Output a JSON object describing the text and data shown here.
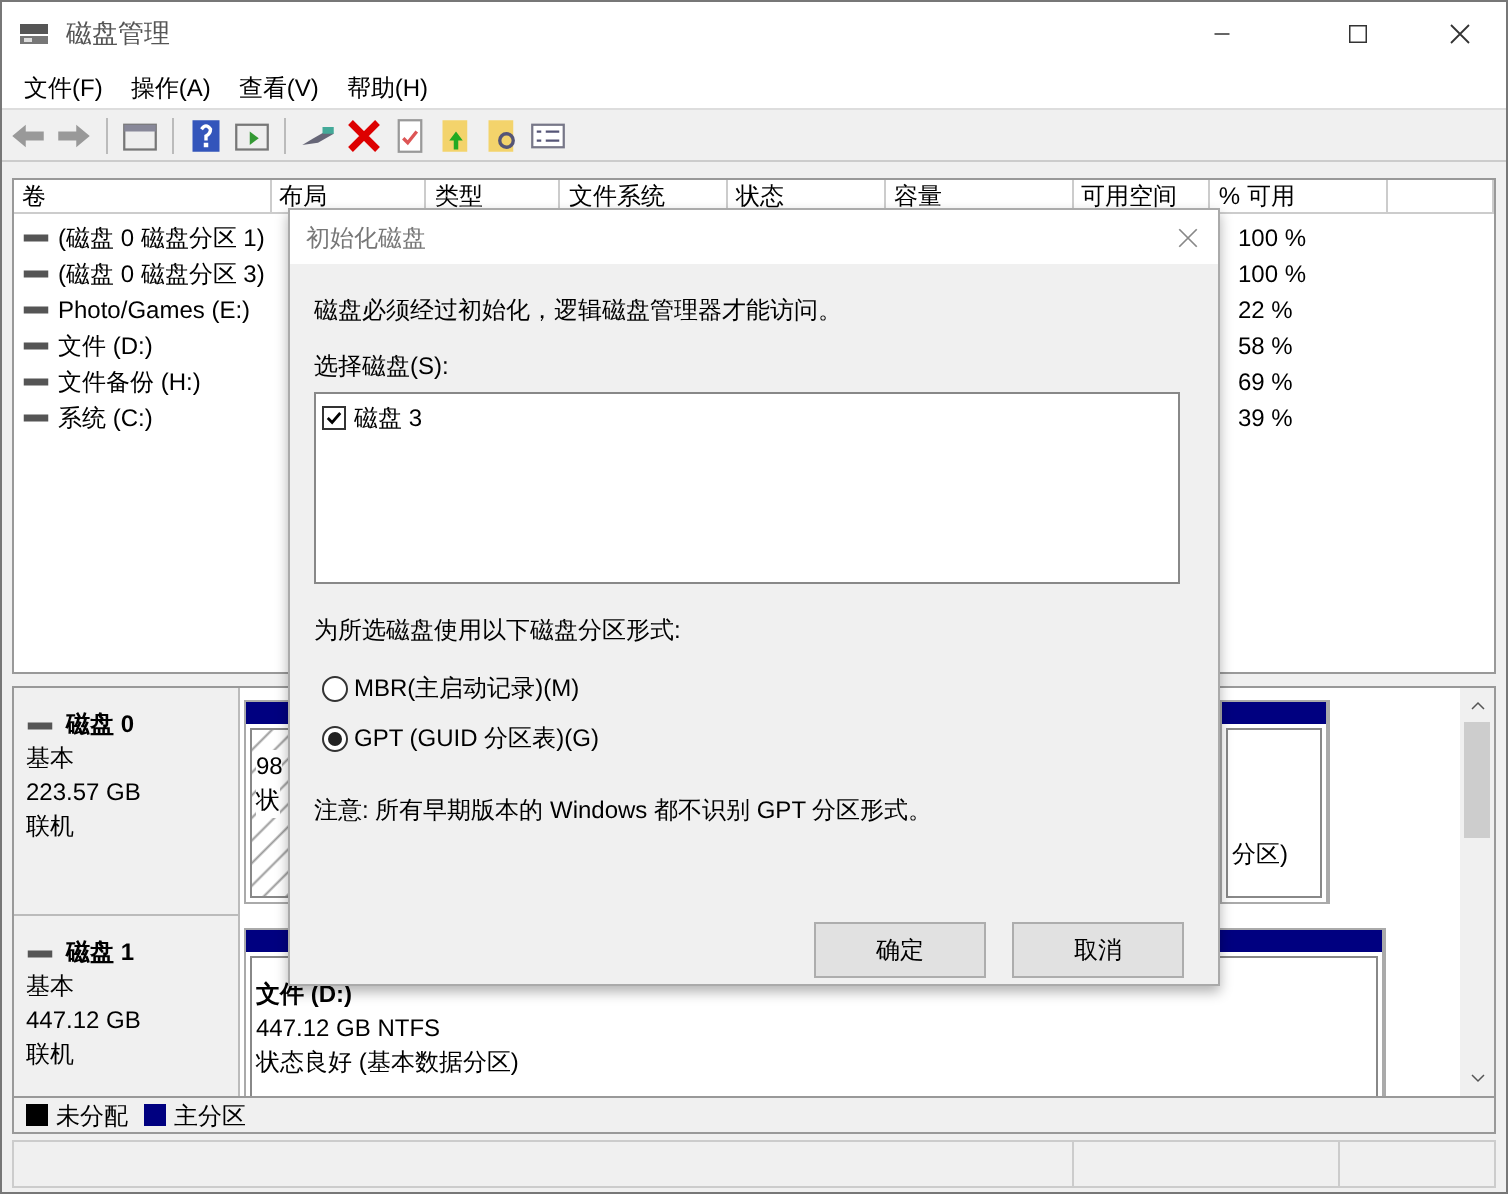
{
  "window": {
    "title": "磁盘管理"
  },
  "menu": [
    "文件(F)",
    "操作(A)",
    "查看(V)",
    "帮助(H)"
  ],
  "volume_table": {
    "columns": [
      "卷",
      "布局",
      "类型",
      "文件系统",
      "状态",
      "容量",
      "可用空间",
      "% 可用"
    ],
    "rows": [
      {
        "volume": "(磁盘 0 磁盘分区 1)",
        "percent_free": "100 %"
      },
      {
        "volume": "(磁盘 0 磁盘分区 3)",
        "percent_free": "100 %"
      },
      {
        "volume": "Photo/Games (E:)",
        "percent_free": "22 %"
      },
      {
        "volume": "文件 (D:)",
        "percent_free": "58 %"
      },
      {
        "volume": "文件备份 (H:)",
        "percent_free": "69 %"
      },
      {
        "volume": "系统 (C:)",
        "percent_free": "39 %"
      }
    ]
  },
  "disks": [
    {
      "name": "磁盘 0",
      "type": "基本",
      "size": "223.57 GB",
      "status": "联机",
      "partitions": [
        {
          "kind": "hatched",
          "lines": [
            "98",
            "状"
          ]
        },
        {
          "kind": "primary",
          "lines": [
            "分区)"
          ]
        }
      ]
    },
    {
      "name": "磁盘 1",
      "type": "基本",
      "size": "447.12 GB",
      "status": "联机",
      "partitions": [
        {
          "kind": "primary",
          "title": "文件 (D:)",
          "lines": [
            "447.12 GB NTFS",
            "状态良好 (基本数据分区)"
          ]
        }
      ]
    }
  ],
  "legend": [
    {
      "label": "未分配",
      "color": "#000000"
    },
    {
      "label": "主分区",
      "color": "#000080"
    }
  ],
  "dialog": {
    "title": "初始化磁盘",
    "message": "磁盘必须经过初始化，逻辑磁盘管理器才能访问。",
    "select_label": "选择磁盘(S):",
    "disks": [
      {
        "label": "磁盘 3",
        "checked": true
      }
    ],
    "style_label": "为所选磁盘使用以下磁盘分区形式:",
    "options": [
      {
        "label": "MBR(主启动记录)(M)",
        "selected": false
      },
      {
        "label": "GPT (GUID 分区表)(G)",
        "selected": true
      }
    ],
    "note": "注意: 所有早期版本的 Windows 都不识别 GPT 分区形式。",
    "buttons": [
      "确定",
      "取消"
    ]
  }
}
